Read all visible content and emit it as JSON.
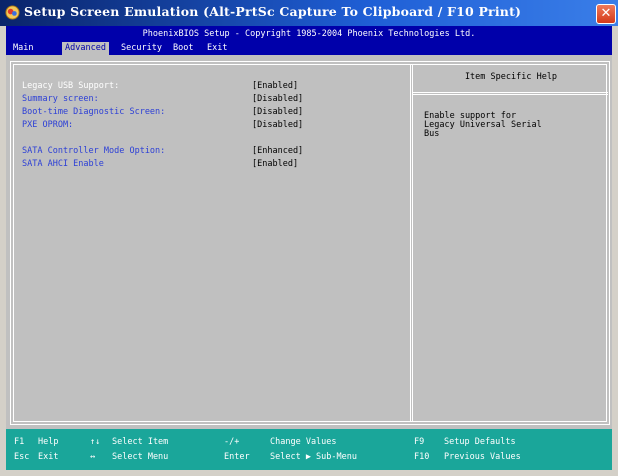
{
  "window": {
    "title": "Setup Screen Emulation (Alt-PrtSc Capture To Clipboard / F10 Print)",
    "close_glyph": "✕"
  },
  "bios": {
    "header": "PhoenixBIOS Setup - Copyright 1985-2004 Phoenix Technologies Ltd.",
    "tabs": [
      {
        "label": "Main"
      },
      {
        "label": "Advanced"
      },
      {
        "label": "Security"
      },
      {
        "label": "Boot"
      },
      {
        "label": "Exit"
      }
    ],
    "active_tab": "Advanced",
    "settings": [
      {
        "label": "Legacy USB Support:",
        "value": "[Enabled]",
        "selected": true
      },
      {
        "label": "Summary screen:",
        "value": "[Disabled]"
      },
      {
        "label": "Boot-time Diagnostic Screen:",
        "value": "[Disabled]"
      },
      {
        "label": "PXE OPROM:",
        "value": "[Disabled]"
      },
      {
        "label": "SATA Controller Mode Option:",
        "value": "[Enhanced]"
      },
      {
        "label": "SATA AHCI Enable",
        "value": "[Enabled]"
      }
    ],
    "help": {
      "heading": "Item Specific Help",
      "lines": [
        "Enable support for",
        "Legacy Universal Serial",
        "Bus"
      ]
    },
    "footer": {
      "f1_key": "F1",
      "f1_text": "Help",
      "esc_key": "Esc",
      "esc_text": "Exit",
      "updown_key": "↑↓",
      "updown_text": "Select Item",
      "leftright_key": "↔",
      "leftright_text": "Select Menu",
      "plusminus_key": "-/+",
      "plusminus_text": "Change Values",
      "enter_key": "Enter",
      "enter_text": "Select ▶ Sub-Menu",
      "f9_key": "F9",
      "f9_text": "Setup Defaults",
      "f10_key": "F10",
      "f10_text": "Previous Values"
    }
  },
  "colors": {
    "bios_blue": "#0000aa",
    "bios_gray": "#c0c0c0",
    "label_blue": "#2c3fd6",
    "footer_teal": "#1aa69a"
  },
  "icons": {
    "title_icon": "setup-emulation-icon",
    "close_icon": "close-icon"
  }
}
